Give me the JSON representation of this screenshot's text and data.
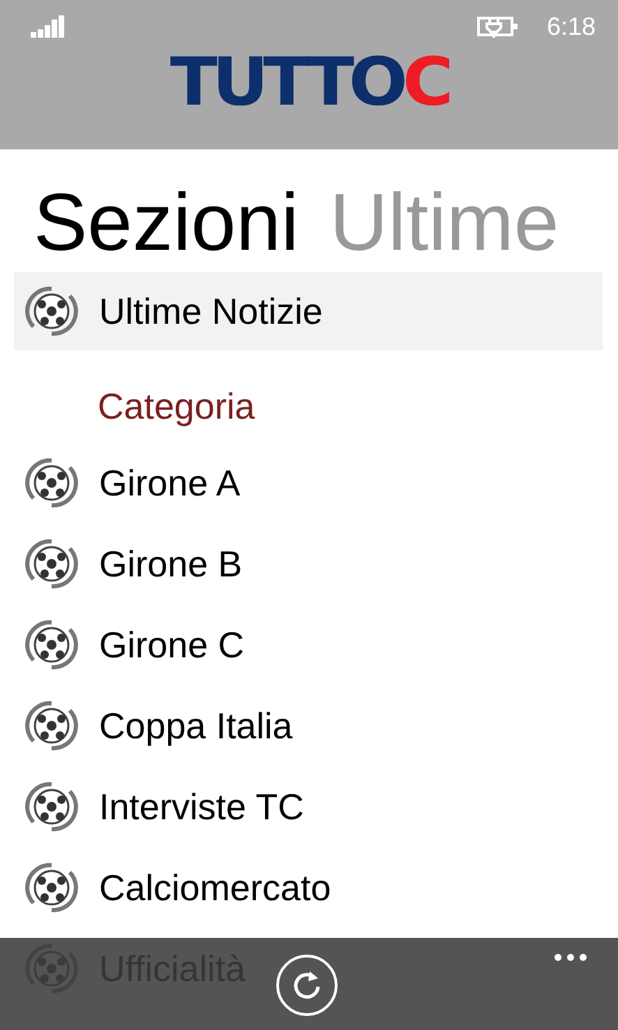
{
  "status_bar": {
    "time": "6:18"
  },
  "logo": {
    "parts": [
      {
        "text": "TUTTO",
        "color": "#0d2f6b"
      },
      {
        "text": "C",
        "color": "#ee1c25"
      }
    ]
  },
  "pivot": [
    {
      "label": "Sezioni",
      "selected": true
    },
    {
      "label": "Ultime",
      "selected": false
    }
  ],
  "featured": [
    {
      "label": "Ultime Notizie",
      "selected": true
    }
  ],
  "category_heading": "Categoria",
  "categories": [
    {
      "label": "Girone A",
      "selected": false
    },
    {
      "label": "Girone B",
      "selected": false
    },
    {
      "label": "Girone C",
      "selected": false
    },
    {
      "label": "Coppa Italia",
      "selected": false
    },
    {
      "label": "Interviste TC",
      "selected": false
    },
    {
      "label": "Calciomercato",
      "selected": false
    },
    {
      "label": "Ufficialità",
      "selected": false
    }
  ]
}
